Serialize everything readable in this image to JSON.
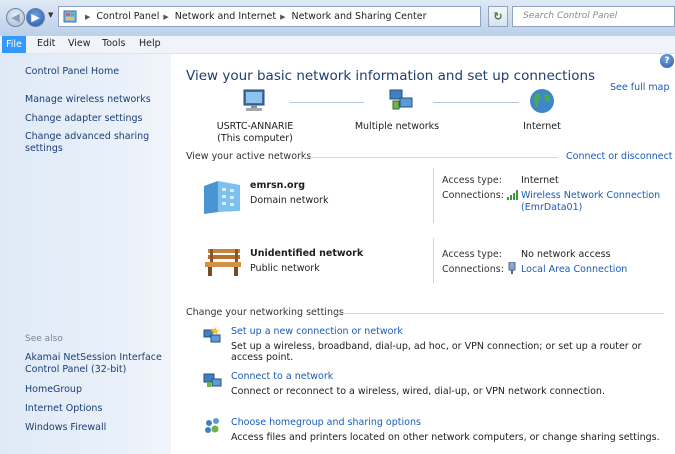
{
  "addressbar": {
    "crumbs": [
      "Control Panel",
      "Network and Internet",
      "Network and Sharing Center"
    ],
    "search_placeholder": "Search Control Panel"
  },
  "menubar": [
    "File",
    "Edit",
    "View",
    "Tools",
    "Help"
  ],
  "sidebar": {
    "items": [
      "Control Panel Home",
      "Manage wireless networks",
      "Change adapter settings",
      "Change advanced sharing",
      "settings"
    ],
    "see_also_label": "See also",
    "see_also": [
      "Akamai NetSession Interface",
      "Control Panel (32-bit)",
      "HomeGroup",
      "Internet Options",
      "Windows Firewall"
    ]
  },
  "main": {
    "title": "View your basic network information and set up connections",
    "see_full_map": "See full map",
    "map": {
      "computer_name": "USRTC-ANNARIE",
      "computer_sub": "(This computer)",
      "middle": "Multiple networks",
      "internet": "Internet"
    },
    "active_networks_label": "View your active networks",
    "connect_disconnect": "Connect or disconnect",
    "networks": [
      {
        "name": "emrsn.org",
        "type": "Domain network",
        "access_label": "Access type:",
        "access": "Internet",
        "connections_label": "Connections:",
        "connection": "Wireless Network Connection",
        "connection_sub": "(EmrData01)"
      },
      {
        "name": "Unidentified network",
        "type": "Public network",
        "access_label": "Access type:",
        "access": "No network access",
        "connections_label": "Connections:",
        "connection": "Local Area Connection"
      }
    ],
    "change_settings_label": "Change your networking settings",
    "tasks": [
      {
        "title": "Set up a new connection or network",
        "desc": "Set up a wireless, broadband, dial-up, ad hoc, or VPN connection; or set up a router or access point."
      },
      {
        "title": "Connect to a network",
        "desc": "Connect or reconnect to a wireless, wired, dial-up, or VPN network connection."
      },
      {
        "title": "Choose homegroup and sharing options",
        "desc": "Access files and printers located on other network computers, or change sharing settings."
      }
    ]
  }
}
